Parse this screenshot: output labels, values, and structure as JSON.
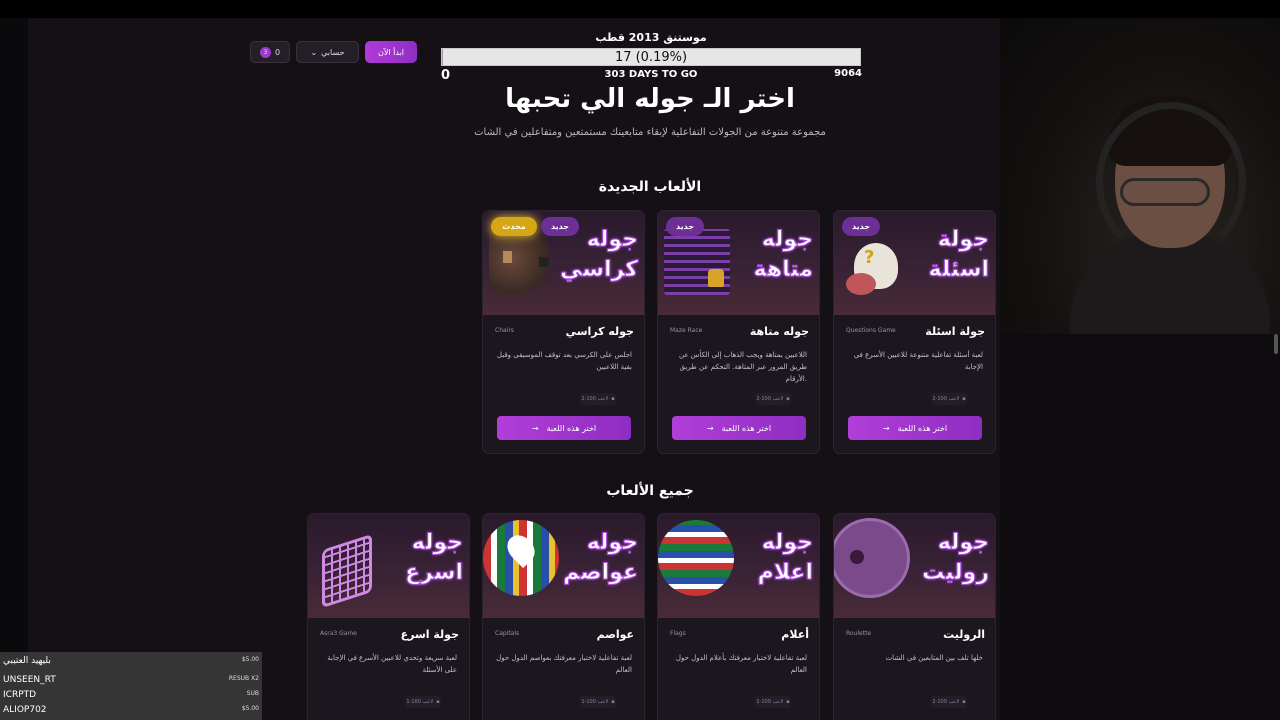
{
  "header": {
    "start_label": "ابدأ الآن",
    "account_label": "حسابي",
    "coins_value": "0",
    "coins_badge": "3"
  },
  "goal": {
    "title": "موستنق 2013 قطب",
    "progress_text": "17 (0.19%)",
    "progress_percent": 0.19,
    "min": "0",
    "max": "9064",
    "days": "303 DAYS TO GO"
  },
  "hero": {
    "title": "اختر الـ جوله الي تحبها",
    "subtitle": "مجموعة متنوعة من الجولات التفاعلية لإبقاء متابعينك مستمتعين ومتفاعلين في الشات"
  },
  "sections": {
    "new_title": "الألعاب الجديدة",
    "all_title": "جميع الألعاب"
  },
  "new_games": [
    {
      "banner": "جوله كراسي",
      "name": "جوله كراسي",
      "eng": "Chairs",
      "desc": "اجلس على الكرسي بعد توقف الموسيقى وقبل بقية اللاعبين",
      "players": "2-100 لاعب",
      "cta": "اختر هذه اللعبة",
      "badges": [
        "جديد",
        "محدث"
      ]
    },
    {
      "banner": "جوله متاهة",
      "name": "جوله متاهة",
      "eng": "Maze Race",
      "desc": "اللاعبين بمتاهة ويجب الذهاب إلى الكأس عن طريق المرور عبر المتاهة. التحكم عن طريق الأرقام.",
      "players": "2-100 لاعب",
      "cta": "اختر هذه اللعبة",
      "badges": [
        "جديد"
      ]
    },
    {
      "banner": "جولة اسئلة",
      "name": "جولة اسئلة",
      "eng": "Questions Game",
      "desc": "لعبة أسئلة تفاعلية متنوعة للاعبين الأسرع في الإجابة",
      "players": "2-100 لاعب",
      "cta": "اختر هذه اللعبة",
      "badges": [
        "جديد"
      ]
    }
  ],
  "all_games": [
    {
      "banner": "جوله اسرع",
      "name": "جولة اسرع",
      "eng": "Asra3 Game",
      "desc": "لعبة سريعة وتحدي للاعبين الأسرع في الإجابة على الأسئلة",
      "players": "1-100 لاعب"
    },
    {
      "banner": "جوله عواصم",
      "name": "عواصم",
      "eng": "Capitals",
      "desc": "لعبة تفاعلية لاختبار معرفتك بعواصم الدول حول العالم",
      "players": "1-100 لاعب"
    },
    {
      "banner": "جوله اعلام",
      "name": "أعلام",
      "eng": "Flags",
      "desc": "لعبة تفاعلية لاختبار معرفتك بأعلام الدول حول العالم",
      "players": "1-100 لاعب"
    },
    {
      "banner": "جوله روليت",
      "name": "الروليت",
      "eng": "Roulette",
      "desc": "خلها تلف بين المتابعين في الشات",
      "players": "2-100 لاعب"
    }
  ],
  "chat": [
    {
      "user": "بليهيد العتيبي",
      "amount": "$5.00"
    },
    {
      "user": "UNSEEN_RT",
      "amount": "RESUB X2"
    },
    {
      "user": "ICRPTD",
      "amount": "SUB"
    },
    {
      "user": "ALIOP702",
      "amount": "$5.00"
    }
  ],
  "colors": {
    "accent": "#a438d6",
    "badge_new": "#6d2f96",
    "badge_updated": "#d6a614"
  }
}
